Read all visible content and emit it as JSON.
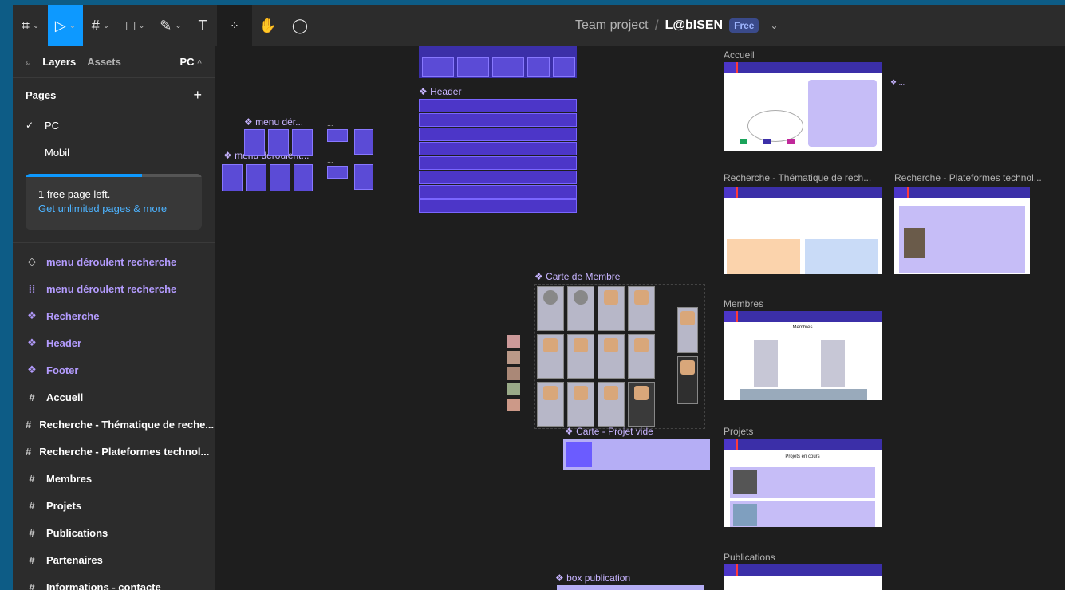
{
  "toolbar": {
    "file_team": "Team project",
    "file_name": "L@bISEN",
    "plan_badge": "Free"
  },
  "sidebar": {
    "tabs": {
      "layers": "Layers",
      "assets": "Assets",
      "page_selector": "PC"
    },
    "pages_label": "Pages",
    "pages": [
      {
        "label": "PC",
        "selected": true
      },
      {
        "label": "Mobil",
        "selected": false
      }
    ],
    "upsell": {
      "line1": "1 free page left.",
      "link": "Get unlimited pages & more",
      "progress": 0.66
    },
    "layers": [
      {
        "label": "menu déroulent recherche",
        "kind": "variant"
      },
      {
        "label": "menu déroulent recherche",
        "kind": "component-set"
      },
      {
        "label": "Recherche",
        "kind": "component"
      },
      {
        "label": "Header",
        "kind": "component"
      },
      {
        "label": "Footer",
        "kind": "component"
      },
      {
        "label": "Accueil",
        "kind": "frame"
      },
      {
        "label": "Recherche - Thématique de reche...",
        "kind": "frame"
      },
      {
        "label": "Recherche - Plateformes technol...",
        "kind": "frame"
      },
      {
        "label": "Membres",
        "kind": "frame"
      },
      {
        "label": "Projets",
        "kind": "frame"
      },
      {
        "label": "Publications",
        "kind": "frame"
      },
      {
        "label": "Partenaires",
        "kind": "frame"
      },
      {
        "label": "Informations - contacte",
        "kind": "frame"
      }
    ]
  },
  "canvas": {
    "labels": {
      "header": "Header",
      "menu_der": "menu dér...",
      "menu_deroulent": "menu déroulent...",
      "carte_membre": "Carte de Membre",
      "carte_projet": "Carte - Projet vide",
      "box_publication": "box publication",
      "accueil": "Accueil",
      "recherche_thematique": "Recherche - Thématique de rech...",
      "recherche_plateformes": "Recherche - Plateformes technol...",
      "membres": "Membres",
      "projets": "Projets",
      "publications": "Publications",
      "dots": "...",
      "membres_heading": "Membres",
      "projets_heading": "Projets en cours"
    }
  }
}
